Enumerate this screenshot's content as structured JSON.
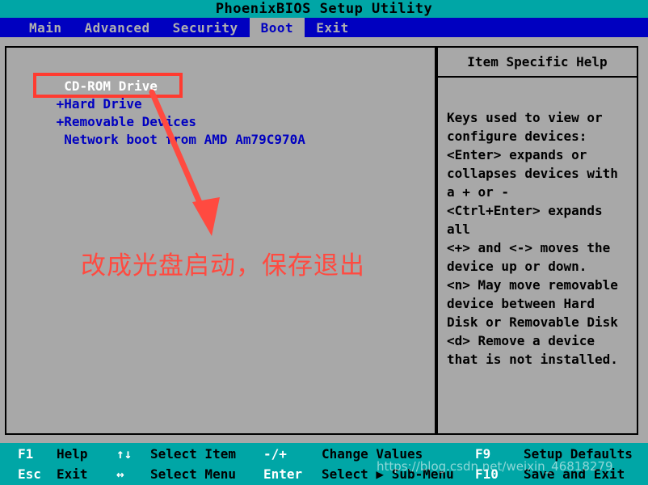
{
  "window": {
    "title": "PhoenixBIOS Setup Utility"
  },
  "menu": {
    "tabs": [
      {
        "label": "Main",
        "active": false
      },
      {
        "label": "Advanced",
        "active": false
      },
      {
        "label": "Security",
        "active": false
      },
      {
        "label": "Boot",
        "active": true
      },
      {
        "label": "Exit",
        "active": false
      }
    ]
  },
  "boot_order": {
    "items": [
      {
        "label": "  CD-ROM Drive",
        "selected": true
      },
      {
        "label": " +Hard Drive",
        "selected": false
      },
      {
        "label": " +Removable Devices",
        "selected": false
      },
      {
        "label": "  Network boot from AMD Am79C970A",
        "selected": false
      }
    ]
  },
  "help": {
    "title": "Item Specific Help",
    "lines": [
      "Keys used to view or",
      "configure devices:",
      "<Enter> expands or",
      "collapses devices with",
      "a + or -",
      "<Ctrl+Enter> expands",
      "all",
      "<+> and <-> moves the",
      "device up or down.",
      "<n> May move removable",
      "device between Hard",
      "Disk or Removable Disk",
      "<d> Remove a device",
      "that is not installed."
    ]
  },
  "status_bar": {
    "row1": [
      {
        "key": "F1",
        "desc": "Help"
      },
      {
        "key": "↑↓",
        "desc": "Select Item"
      },
      {
        "key": "-/+",
        "desc": "Change Values"
      },
      {
        "key": "F9",
        "desc": "Setup Defaults"
      }
    ],
    "row2": [
      {
        "key": "Esc",
        "desc": "Exit"
      },
      {
        "key": "↔",
        "desc": "Select Menu"
      },
      {
        "key": "Enter",
        "desc": "Select ▶ Sub-Menu"
      },
      {
        "key": "F10",
        "desc": "Save and Exit"
      }
    ]
  },
  "annotations": {
    "highlight_note": "改成光盘启动，保存退出",
    "highlight_color": "#ff3b30"
  },
  "watermark": {
    "text": "https://blog.csdn.net/weixin_46818279"
  }
}
